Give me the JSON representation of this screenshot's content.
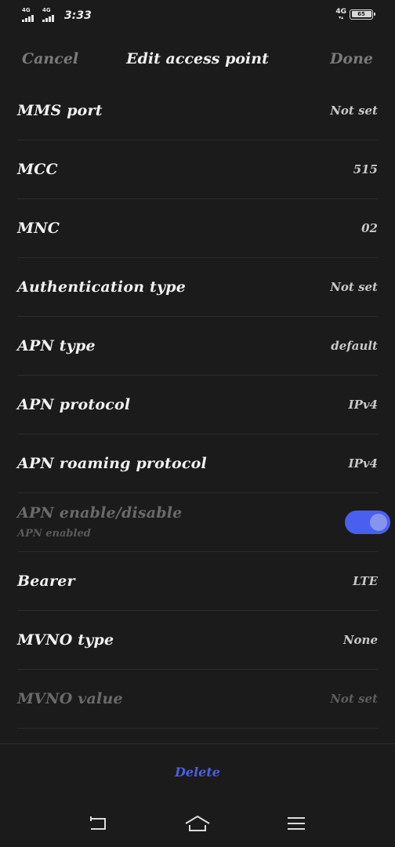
{
  "status_bar": {
    "sim1_network": "4G",
    "sim2_network": "4G",
    "time": "3:33",
    "network_right": "4G",
    "battery_level": "65",
    "signal_strength_sim1": 4,
    "signal_strength_sim2": 4
  },
  "header": {
    "cancel_label": "Cancel",
    "title": "Edit access point",
    "done_label": "Done"
  },
  "rows": [
    {
      "label": "MMS port",
      "value": "Not set"
    },
    {
      "label": "MCC",
      "value": "515"
    },
    {
      "label": "MNC",
      "value": "02"
    },
    {
      "label": "Authentication type",
      "value": "Not set"
    },
    {
      "label": "APN type",
      "value": "default"
    },
    {
      "label": "APN protocol",
      "value": "IPv4"
    },
    {
      "label": "APN roaming protocol",
      "value": "IPv4"
    }
  ],
  "apn_toggle": {
    "label": "APN enable/disable",
    "sublabel": "APN enabled",
    "enabled": true
  },
  "rows2": [
    {
      "label": "Bearer",
      "value": "LTE"
    },
    {
      "label": "MVNO type",
      "value": "None"
    },
    {
      "label": "MVNO value",
      "value": "Not set",
      "disabled": true
    }
  ],
  "footer": {
    "delete_label": "Delete"
  },
  "colors": {
    "background": "#1b1b1b",
    "accent": "#4b5fe8",
    "toggle_track": "#4a5ff0",
    "toggle_knob": "#8794ee"
  },
  "icons": {
    "nav_back": "back-icon",
    "nav_home": "home-icon",
    "nav_menu": "menu-icon"
  }
}
